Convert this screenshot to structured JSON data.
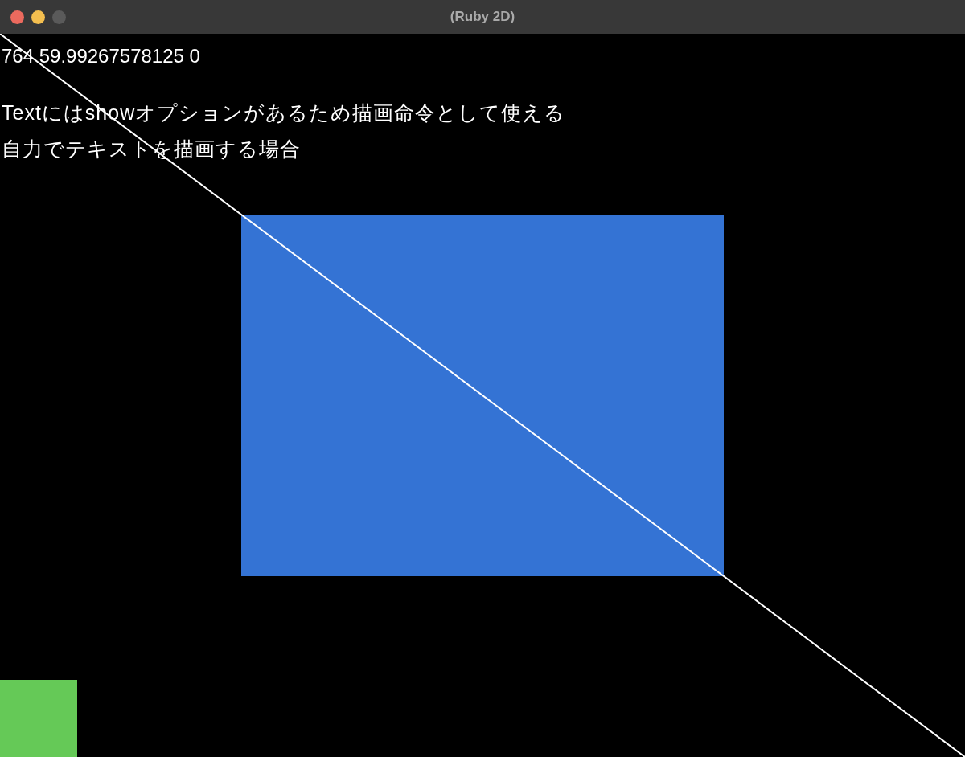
{
  "window": {
    "title": "(Ruby 2D)"
  },
  "canvas": {
    "texts": [
      "764 59.99267578125 0",
      "Textにはshowオプションがあるため描画命令として使える",
      "自力でテキストを描画する場合"
    ]
  }
}
